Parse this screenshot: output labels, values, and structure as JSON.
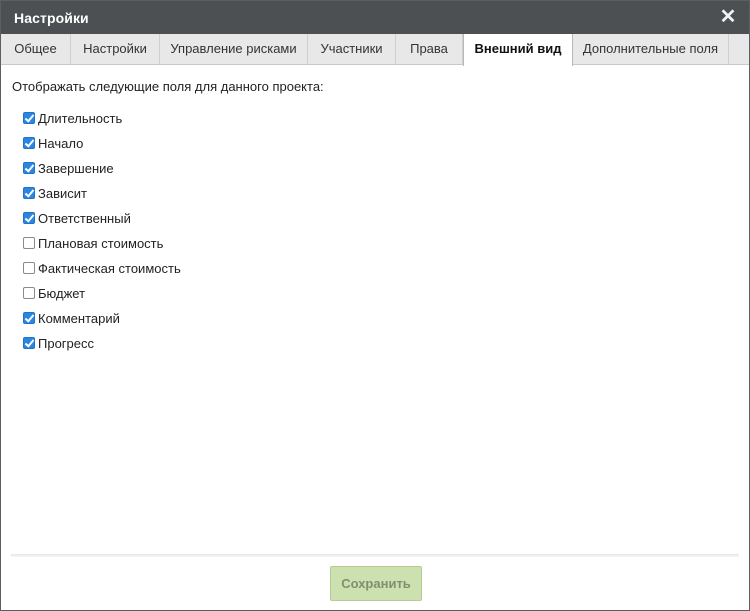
{
  "dialog": {
    "title": "Настройки",
    "close_glyph": "✕"
  },
  "tabs": [
    {
      "label": "Общее",
      "active": false
    },
    {
      "label": "Настройки",
      "active": false
    },
    {
      "label": "Управление рисками",
      "active": false
    },
    {
      "label": "Участники",
      "active": false
    },
    {
      "label": "Права",
      "active": false
    },
    {
      "label": "Внешний вид",
      "active": true
    },
    {
      "label": "Дополнительные поля",
      "active": false
    }
  ],
  "content": {
    "intro": "Отображать следующие поля для данного проекта:",
    "fields": [
      {
        "label": "Длительность",
        "checked": true
      },
      {
        "label": "Начало",
        "checked": true
      },
      {
        "label": "Завершение",
        "checked": true
      },
      {
        "label": "Зависит",
        "checked": true
      },
      {
        "label": "Ответственный",
        "checked": true
      },
      {
        "label": "Плановая стоимость",
        "checked": false
      },
      {
        "label": "Фактическая стоимость",
        "checked": false
      },
      {
        "label": "Бюджет",
        "checked": false
      },
      {
        "label": "Комментарий",
        "checked": true
      },
      {
        "label": "Прогресс",
        "checked": true
      }
    ]
  },
  "footer": {
    "save_label": "Сохранить"
  },
  "colors": {
    "titlebar": "#4d5053",
    "checkbox_checked": "#2a86e0",
    "save_button": "#cde0b0"
  }
}
